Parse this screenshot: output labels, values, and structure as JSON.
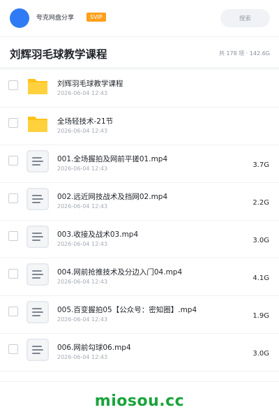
{
  "header": {
    "share_name": "夸克网盘分享",
    "badge": "SVIP",
    "search_placeholder": "搜索",
    "avatar_color": "#2f7bf5",
    "badge_color": "#ff9f1a"
  },
  "title_bar": {
    "title": "刘辉羽毛球教学课程",
    "summary": "共 178 项 · 142.6G"
  },
  "files": [
    {
      "type": "folder-icon",
      "name": "刘辉羽毛球教学课程",
      "date": "2026-06-04 12:43",
      "size": ""
    },
    {
      "type": "folder-icon",
      "name": "全场轻技术-21节",
      "date": "2026-06-04 12:43",
      "size": ""
    },
    {
      "type": "document-icon",
      "name": "001.全场握拍及网前平搓01.mp4",
      "date": "2026-06-04 12:43",
      "size": "3.7G"
    },
    {
      "type": "document-icon",
      "name": "002.远近网技战术及挡网02.mp4",
      "date": "2026-06-04 12:43",
      "size": "2.2G"
    },
    {
      "type": "document-icon",
      "name": "003.收接及战术03.mp4",
      "date": "2026-06-04 12:43",
      "size": "3.0G"
    },
    {
      "type": "document-icon",
      "name": "004.网前抢推技术及分边入门04.mp4",
      "date": "2026-06-04 12:43",
      "size": "4.1G"
    },
    {
      "type": "document-icon",
      "name": "005.百变握拍05【公众号：密知圈】.mp4",
      "date": "2026-06-04 12:43",
      "size": "1.9G"
    },
    {
      "type": "document-icon",
      "name": "006.网前勾球06.mp4",
      "date": "2026-06-04 12:43",
      "size": "3.0G"
    }
  ],
  "watermark": {
    "text": "miosou.cc",
    "color": "#1aa33b"
  }
}
